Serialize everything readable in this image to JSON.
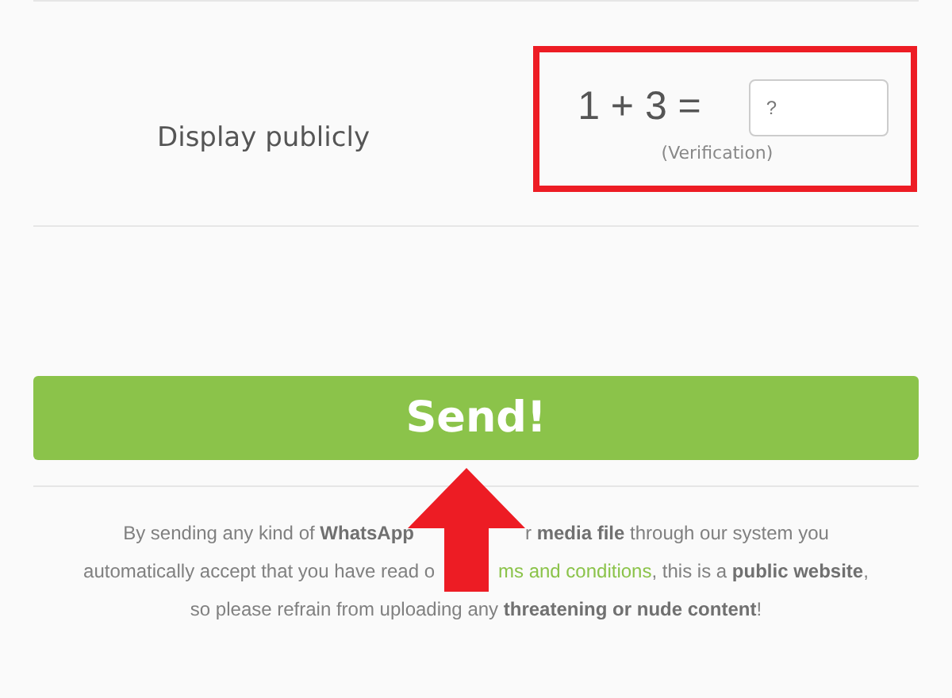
{
  "visibility_row": {
    "label": "Display publicly"
  },
  "captcha": {
    "question": "1 + 3 =",
    "placeholder": "?",
    "note": "(Verification)"
  },
  "send_button": {
    "label": "Send!"
  },
  "notice": [
    {
      "segments": [
        {
          "kind": "text",
          "text": "By sending any kind of **WhatsApp**"
        },
        {
          "kind": "text",
          "text": "r **media file** through our system you"
        }
      ]
    },
    {
      "segments": [
        {
          "kind": "text",
          "text": "automatically accept that you have read o"
        },
        {
          "kind": "link",
          "text": "ms and conditions"
        },
        {
          "kind": "text",
          "text": ", this is a **public website**,"
        }
      ]
    },
    {
      "segments": [
        {
          "kind": "text",
          "text": "so please refrain from uploading any **threatening or nude content**!"
        }
      ]
    }
  ]
}
